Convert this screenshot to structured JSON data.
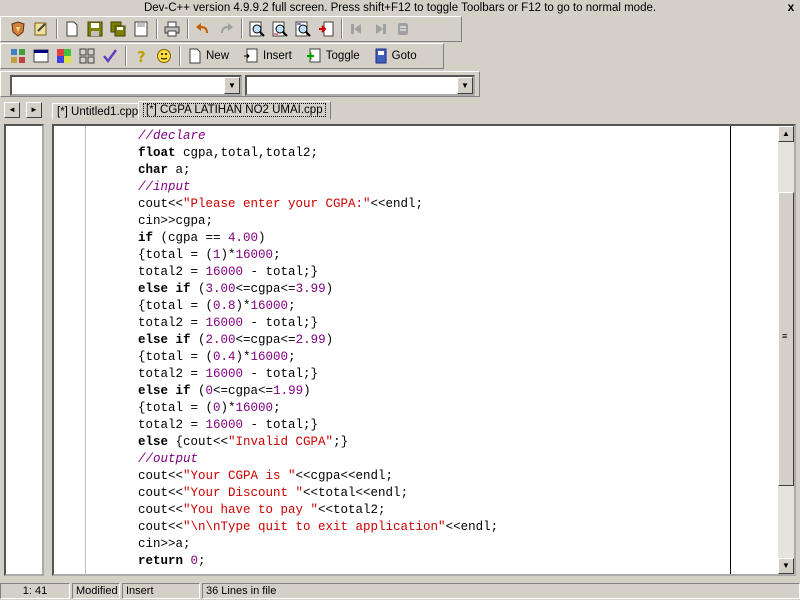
{
  "window": {
    "title": "Dev-C++ version 4.9.9.2 full screen. Press shift+F12 to toggle Toolbars or F12 to go to normal mode.",
    "close_glyph": "x"
  },
  "toolbar2": {
    "new_label": "New",
    "insert_label": "Insert",
    "toggle_label": "Toggle",
    "goto_label": "Goto"
  },
  "combos": {
    "class_value": "",
    "member_value": ""
  },
  "tabs": [
    {
      "label": "[*] Untitled1.cpp"
    },
    {
      "label": "[*] CGPA LATIHAN NO2 UMAI.cpp"
    }
  ],
  "tab_nav": {
    "left": "◄",
    "right": "►"
  },
  "code_lines": [
    [
      {
        "t": "cm",
        "v": "//declare"
      }
    ],
    [
      {
        "t": "kw",
        "v": "float"
      },
      {
        "t": "pl",
        "v": " cgpa,total,total2;"
      }
    ],
    [
      {
        "t": "kw",
        "v": "char"
      },
      {
        "t": "pl",
        "v": " a;"
      }
    ],
    [
      {
        "t": "cm",
        "v": "//input"
      }
    ],
    [
      {
        "t": "pl",
        "v": "cout<<"
      },
      {
        "t": "st",
        "v": "\"Please enter your CGPA:\""
      },
      {
        "t": "pl",
        "v": "<<endl;"
      }
    ],
    [
      {
        "t": "pl",
        "v": "cin>>cgpa;"
      }
    ],
    [
      {
        "t": "kw",
        "v": "if"
      },
      {
        "t": "pl",
        "v": " (cgpa == "
      },
      {
        "t": "nm",
        "v": "4.00"
      },
      {
        "t": "pl",
        "v": ")"
      }
    ],
    [
      {
        "t": "pl",
        "v": "{total = ("
      },
      {
        "t": "nm",
        "v": "1"
      },
      {
        "t": "pl",
        "v": ")*"
      },
      {
        "t": "nm",
        "v": "16000"
      },
      {
        "t": "pl",
        "v": ";"
      }
    ],
    [
      {
        "t": "pl",
        "v": "total2 = "
      },
      {
        "t": "nm",
        "v": "16000"
      },
      {
        "t": "pl",
        "v": " - total;}"
      }
    ],
    [
      {
        "t": "kw",
        "v": "else if"
      },
      {
        "t": "pl",
        "v": " ("
      },
      {
        "t": "nm",
        "v": "3.00"
      },
      {
        "t": "pl",
        "v": "<=cgpa<="
      },
      {
        "t": "nm",
        "v": "3.99"
      },
      {
        "t": "pl",
        "v": ")"
      }
    ],
    [
      {
        "t": "pl",
        "v": "{total = ("
      },
      {
        "t": "nm",
        "v": "0.8"
      },
      {
        "t": "pl",
        "v": ")*"
      },
      {
        "t": "nm",
        "v": "16000"
      },
      {
        "t": "pl",
        "v": ";"
      }
    ],
    [
      {
        "t": "pl",
        "v": "total2 = "
      },
      {
        "t": "nm",
        "v": "16000"
      },
      {
        "t": "pl",
        "v": " - total;}"
      }
    ],
    [
      {
        "t": "kw",
        "v": "else if"
      },
      {
        "t": "pl",
        "v": " ("
      },
      {
        "t": "nm",
        "v": "2.00"
      },
      {
        "t": "pl",
        "v": "<=cgpa<="
      },
      {
        "t": "nm",
        "v": "2.99"
      },
      {
        "t": "pl",
        "v": ")"
      }
    ],
    [
      {
        "t": "pl",
        "v": "{total = ("
      },
      {
        "t": "nm",
        "v": "0.4"
      },
      {
        "t": "pl",
        "v": ")*"
      },
      {
        "t": "nm",
        "v": "16000"
      },
      {
        "t": "pl",
        "v": ";"
      }
    ],
    [
      {
        "t": "pl",
        "v": "total2 = "
      },
      {
        "t": "nm",
        "v": "16000"
      },
      {
        "t": "pl",
        "v": " - total;}"
      }
    ],
    [
      {
        "t": "kw",
        "v": "else if"
      },
      {
        "t": "pl",
        "v": " ("
      },
      {
        "t": "nm",
        "v": "0"
      },
      {
        "t": "pl",
        "v": "<=cgpa<="
      },
      {
        "t": "nm",
        "v": "1.99"
      },
      {
        "t": "pl",
        "v": ")"
      }
    ],
    [
      {
        "t": "pl",
        "v": "{total = ("
      },
      {
        "t": "nm",
        "v": "0"
      },
      {
        "t": "pl",
        "v": ")*"
      },
      {
        "t": "nm",
        "v": "16000"
      },
      {
        "t": "pl",
        "v": ";"
      }
    ],
    [
      {
        "t": "pl",
        "v": "total2 = "
      },
      {
        "t": "nm",
        "v": "16000"
      },
      {
        "t": "pl",
        "v": " - total;}"
      }
    ],
    [
      {
        "t": "kw",
        "v": "else"
      },
      {
        "t": "pl",
        "v": " {cout<<"
      },
      {
        "t": "st",
        "v": "\"Invalid CGPA\""
      },
      {
        "t": "pl",
        "v": ";}"
      }
    ],
    [
      {
        "t": "cm",
        "v": "//output"
      }
    ],
    [
      {
        "t": "pl",
        "v": "cout<<"
      },
      {
        "t": "st",
        "v": "\"Your CGPA is \""
      },
      {
        "t": "pl",
        "v": "<<cgpa<<endl;"
      }
    ],
    [
      {
        "t": "pl",
        "v": "cout<<"
      },
      {
        "t": "st",
        "v": "\"Your Discount \""
      },
      {
        "t": "pl",
        "v": "<<total<<endl;"
      }
    ],
    [
      {
        "t": "pl",
        "v": "cout<<"
      },
      {
        "t": "st",
        "v": "\"You have to pay \""
      },
      {
        "t": "pl",
        "v": "<<total2;"
      }
    ],
    [
      {
        "t": "pl",
        "v": "cout<<"
      },
      {
        "t": "st",
        "v": "\"\\n\\nType quit to exit application\""
      },
      {
        "t": "pl",
        "v": "<<endl;"
      }
    ],
    [
      {
        "t": "pl",
        "v": "cin>>a;"
      }
    ],
    [
      {
        "t": "kw",
        "v": "return"
      },
      {
        "t": "pl",
        "v": " "
      },
      {
        "t": "nm",
        "v": "0"
      },
      {
        "t": "pl",
        "v": ";"
      }
    ]
  ],
  "scrollbar": {
    "up": "▲",
    "down": "▼",
    "grip": "≡"
  },
  "status": {
    "position": "1: 41",
    "modified": "Modified",
    "mode": "Insert",
    "lines": "36 Lines in file"
  },
  "colors": {
    "keyword": "#000000",
    "comment": "#800080",
    "string": "#cc0000",
    "number": "#800080",
    "chrome": "#d4d0c8"
  }
}
